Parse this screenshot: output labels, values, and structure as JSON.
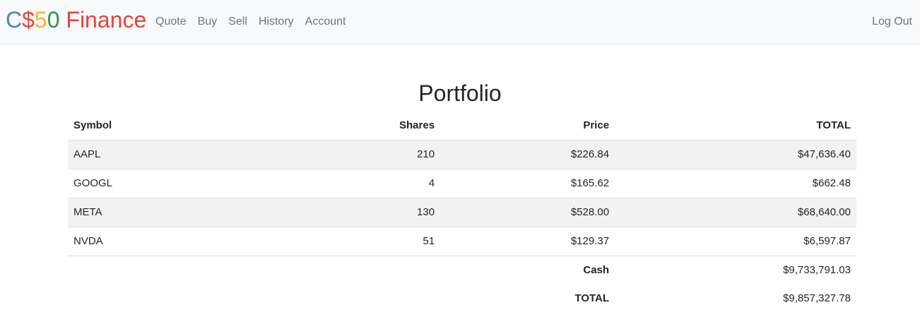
{
  "brand": {
    "parts": [
      {
        "text": "C",
        "color": "#537fbe"
      },
      {
        "text": "$",
        "color": "#ea433b"
      },
      {
        "text": "5",
        "color": "#f5b82e"
      },
      {
        "text": "0",
        "color": "#2e944b"
      },
      {
        "text": " Finance",
        "color": "#ea433b"
      }
    ]
  },
  "nav": {
    "links": [
      "Quote",
      "Buy",
      "Sell",
      "History",
      "Account"
    ],
    "logout": "Log Out"
  },
  "page": {
    "title": "Portfolio"
  },
  "table": {
    "headers": {
      "symbol": "Symbol",
      "shares": "Shares",
      "price": "Price",
      "total": "TOTAL"
    },
    "rows": [
      {
        "symbol": "AAPL",
        "shares": "210",
        "price": "$226.84",
        "total": "$47,636.40"
      },
      {
        "symbol": "GOOGL",
        "shares": "4",
        "price": "$165.62",
        "total": "$662.48"
      },
      {
        "symbol": "META",
        "shares": "130",
        "price": "$528.00",
        "total": "$68,640.00"
      },
      {
        "symbol": "NVDA",
        "shares": "51",
        "price": "$129.37",
        "total": "$6,597.87"
      }
    ],
    "footer": {
      "cash_label": "Cash",
      "cash_value": "$9,733,791.03",
      "total_label": "TOTAL",
      "total_value": "$9,857,327.78"
    }
  }
}
